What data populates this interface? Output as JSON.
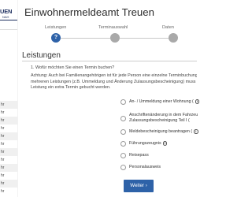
{
  "sidebar": {
    "logo_text": "UEN",
    "logo_sub": "NAH",
    "rows": [
      "hr",
      "hr",
      "hr",
      "hr",
      "hr",
      "hr",
      "hr",
      "hr",
      "hr",
      "hr",
      "hr",
      "hr"
    ]
  },
  "header": {
    "title": "Einwohnermeldeamt Treuen"
  },
  "stepper": {
    "steps": [
      {
        "label": "Leistungen",
        "number": "?"
      },
      {
        "label": "Terminauswahl",
        "number": ""
      },
      {
        "label": "Daten",
        "number": ""
      }
    ]
  },
  "section": {
    "title": "Leistungen",
    "question": "1. Wofür möchten Sie einen Termin buchen?",
    "notice_lines": [
      "Achtung: Auch bei Familienangehörigen ist für jede Person eine einzelne Terminbuchung",
      "mehreren Leistungen (z.B. Ummeldung und Änderung Zulassungsbescheinigung) muss",
      "Leistung ein extra Termin gebucht werden."
    ]
  },
  "options": [
    {
      "label": "An- / Ummeldung einer Wohnung (",
      "info": "i",
      "lines": []
    },
    {
      "label": "",
      "info": "",
      "lines": [
        "Anschriftenänderung in dem Fahrzeu",
        "Zulassungsbescheinigung Teil I ("
      ]
    },
    {
      "label": "Meldebescheinigung beantragen (",
      "info": "i",
      "lines": []
    },
    {
      "label": "Führungszeugnis",
      "info": "i",
      "lines": []
    },
    {
      "label": "Reisepass",
      "info": "",
      "lines": []
    },
    {
      "label": "Personalausweis",
      "info": "",
      "lines": []
    }
  ],
  "actions": {
    "next_label": "Weiter ›"
  },
  "colors": {
    "accent": "#2e62a8",
    "inactive_step": "#a9a9a9",
    "brand": "#1d2f5f"
  },
  "icons": [
    "info-icon"
  ]
}
